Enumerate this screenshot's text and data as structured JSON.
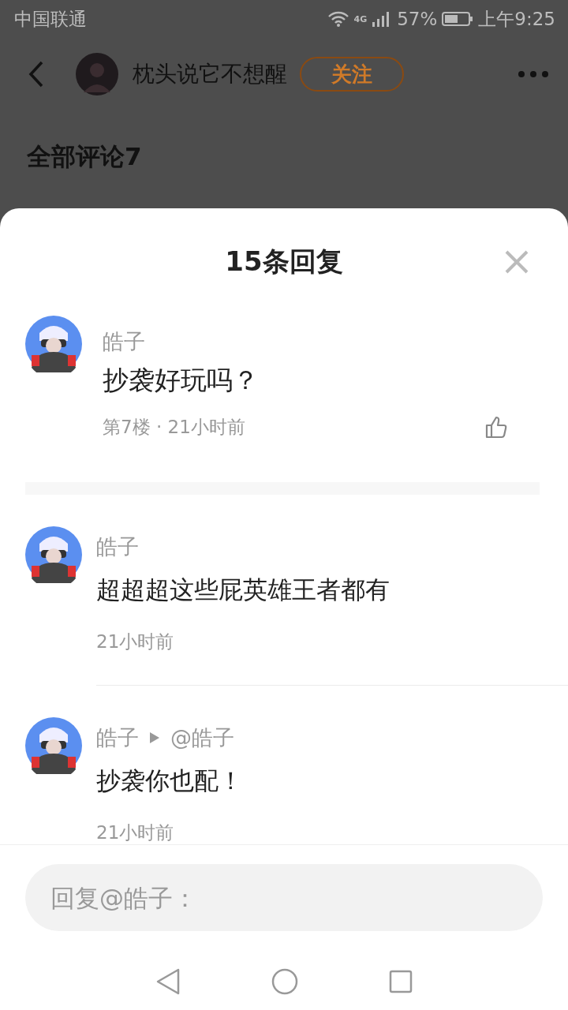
{
  "status_bar": {
    "carrier": "中国联通",
    "network": "4G",
    "battery": "57%",
    "time": "上午9:25"
  },
  "header": {
    "username": "枕头说它不想醒",
    "follow_button": "关注"
  },
  "background_section": {
    "title": "全部评论7"
  },
  "sheet": {
    "title": "15条回复",
    "comment": {
      "user": "皓子",
      "text": "抄袭好玩吗？",
      "meta": "第7楼 · 21小时前"
    },
    "replies": [
      {
        "user": "皓子",
        "text": "超超超这些屁英雄王者都有",
        "time": "21小时前"
      },
      {
        "user": "皓子",
        "reply_to": "@皓子",
        "text": "抄袭你也配！",
        "time": "21小时前"
      }
    ],
    "reply_input": {
      "placeholder": "回复@皓子："
    }
  }
}
